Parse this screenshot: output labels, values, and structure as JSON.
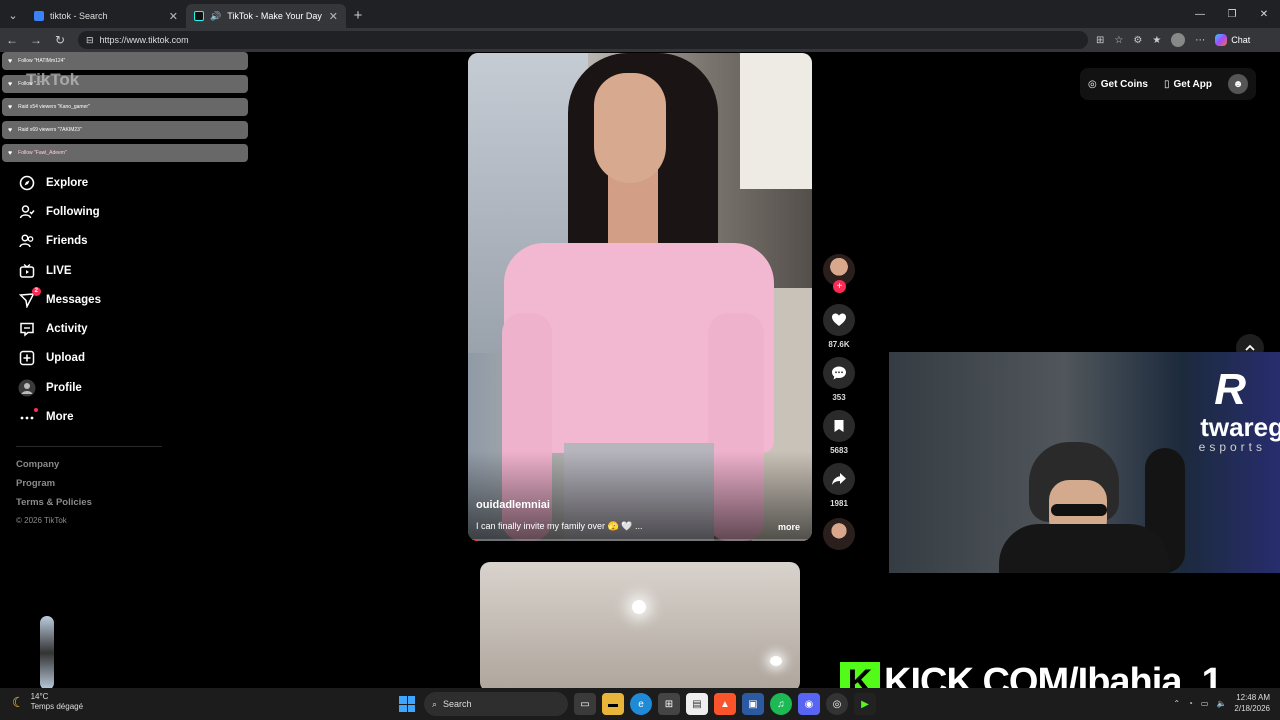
{
  "browser": {
    "tabs": [
      {
        "label": "tiktok - Search",
        "active": false
      },
      {
        "label": "TikTok - Make Your Day",
        "active": true
      }
    ],
    "url": "https://www.tiktok.com",
    "chat_label": "Chat"
  },
  "overlay": {
    "logo": "TikTok",
    "notifications": [
      {
        "text": "Follow \"HATIMm124\""
      },
      {
        "text": "Follow \"...\""
      },
      {
        "text": "Raid x54 viewers \"Kano_gamer\""
      },
      {
        "text": "Raid x69 viewers \"7AKIM23\""
      },
      {
        "text": "Follow \"Fawl_Adeem\""
      }
    ]
  },
  "sidebar": {
    "items": [
      {
        "label": "Explore",
        "icon": "compass-icon"
      },
      {
        "label": "Following",
        "icon": "following-icon"
      },
      {
        "label": "Friends",
        "icon": "friends-icon"
      },
      {
        "label": "LIVE",
        "icon": "live-icon"
      },
      {
        "label": "Messages",
        "icon": "messages-icon",
        "badge": "2"
      },
      {
        "label": "Activity",
        "icon": "activity-icon"
      },
      {
        "label": "Upload",
        "icon": "upload-icon"
      },
      {
        "label": "Profile",
        "icon": "profile-icon"
      },
      {
        "label": "More",
        "icon": "more-icon"
      }
    ],
    "footer": {
      "company": "Company",
      "program": "Program",
      "terms": "Terms & Policies",
      "copyright": "© 2026 TikTok"
    }
  },
  "video": {
    "author": "ouidadlemniai",
    "caption": "I can finally invite my family over 🫣 🤍 ...",
    "more_label": "more",
    "progress": 0.03,
    "likes": "87.6K",
    "comments": "353",
    "saves": "5683",
    "shares": "1981"
  },
  "topbar": {
    "get_coins": "Get Coins",
    "get_app": "Get App"
  },
  "stream": {
    "brand_mark": "R",
    "brand_name": "twareg",
    "brand_sub": "esports",
    "kick_url": "KICK.COM/Ibahja_1"
  },
  "taskbar": {
    "temperature": "14°C",
    "weather": "Temps dégagé",
    "search_label": "Search",
    "time": "12:48 AM",
    "date": "2/18/2026"
  },
  "colors": {
    "accent": "#fe2c55",
    "kick_green": "#53fc18"
  }
}
